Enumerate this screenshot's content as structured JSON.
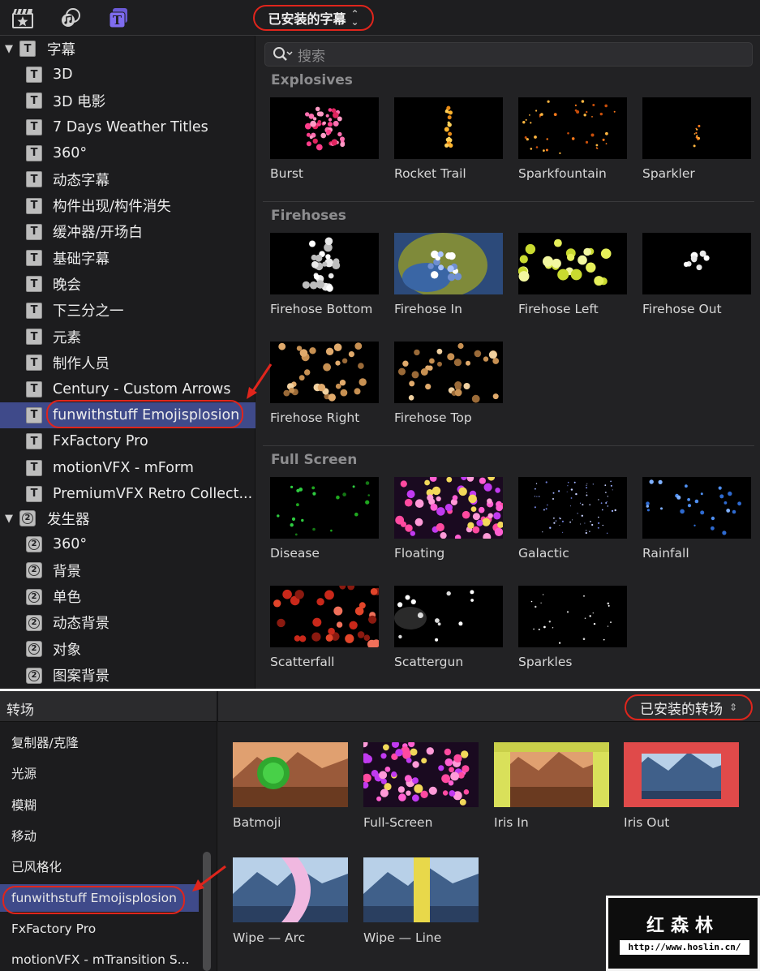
{
  "titles_browser": {
    "toolbar": {
      "icons": [
        "clapper-star-icon",
        "photos-music-icon",
        "titles-icon"
      ],
      "dropdown_label": "已安装的字幕"
    },
    "sidebar": {
      "category_titles": "字幕",
      "title_items": [
        "3D",
        "3D 电影",
        "7 Days Weather Titles",
        "360°",
        "动态字幕",
        "构件出现/构件消失",
        "缓冲器/开场白",
        "基础字幕",
        "晚会",
        "下三分之一",
        "元素",
        "制作人员",
        "Century - Custom Arrows",
        "funwithstuff Emojisplosion",
        "FxFactory Pro",
        "motionVFX - mForm",
        "PremiumVFX Retro Collect..."
      ],
      "selected_title_item": "funwithstuff Emojisplosion",
      "category_generators": "发生器",
      "generator_items": [
        "360°",
        "背景",
        "单色",
        "动态背景",
        "对象",
        "图案背景"
      ]
    },
    "search": {
      "placeholder": "搜索"
    },
    "groups": [
      {
        "title": "Explosives",
        "items": [
          "Burst",
          "Rocket Trail",
          "Sparkfountain",
          "Sparkler"
        ]
      },
      {
        "title": "Firehoses",
        "items": [
          "Firehose Bottom",
          "Firehose In",
          "Firehose Left",
          "Firehose Out",
          "Firehose Right",
          "Firehose Top"
        ]
      },
      {
        "title": "Full Screen",
        "items": [
          "Disease",
          "Floating",
          "Galactic",
          "Rainfall",
          "Scatterfall",
          "Scattergun",
          "Sparkles"
        ]
      }
    ]
  },
  "transitions_browser": {
    "title": "转场",
    "dropdown_label": "已安装的转场",
    "sidebar_items": [
      "复制器/克隆",
      "光源",
      "模糊",
      "移动",
      "已风格化",
      "funwithstuff Emojisplosion",
      "FxFactory Pro",
      "motionVFX - mTransition S..."
    ],
    "selected_item": "funwithstuff Emojisplosion",
    "tiles": [
      "Batmoji",
      "Full-Screen",
      "Iris In",
      "Iris Out",
      "Wipe — Arc",
      "Wipe — Line"
    ]
  },
  "watermark": {
    "name": "红森林",
    "url": "http://www.hoslin.cn/"
  },
  "colors": {
    "highlight_red": "#e0251c",
    "selection_blue": "#3f4a8a"
  }
}
